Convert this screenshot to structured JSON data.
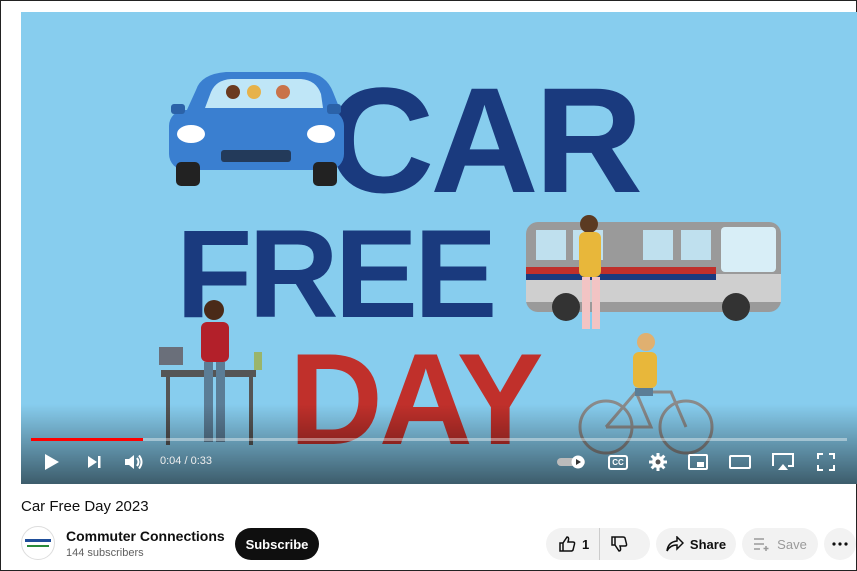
{
  "video": {
    "title": "Car Free Day 2023",
    "artwork_text": {
      "line1": "CAR",
      "line2": "FREE",
      "line3": "DAY"
    },
    "progress_fraction": 0.137,
    "time_display": "0:04 / 0:33"
  },
  "player_controls": {
    "icons": [
      "play-icon",
      "next-icon",
      "volume-icon",
      "autoplay-toggle-icon",
      "captions-icon",
      "settings-icon",
      "miniplayer-icon",
      "theater-icon",
      "cast-icon",
      "fullscreen-icon"
    ],
    "captions_label": "CC"
  },
  "channel": {
    "name": "Commuter Connections",
    "subscribers": "144 subscribers",
    "subscribe_label": "Subscribe"
  },
  "actions": {
    "like_count": "1",
    "share_label": "Share",
    "save_label": "Save"
  },
  "colors": {
    "sky": "#87cdee",
    "title_blue": "#1a3a7e",
    "day_red": "#c0302b",
    "progress_red": "#ff0000"
  }
}
